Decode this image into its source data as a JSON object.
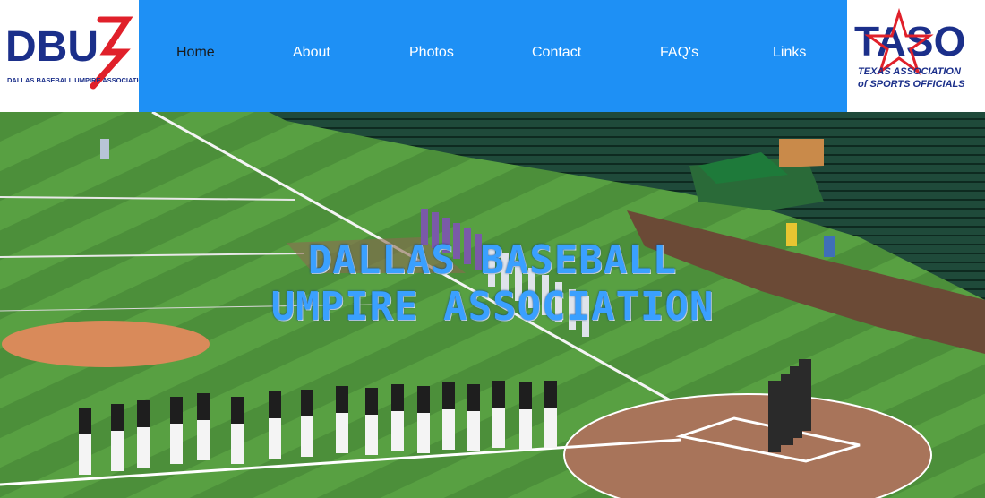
{
  "logo_left": {
    "mark": "DBU",
    "tagline": "DALLAS BASEBALL UMPIRE ASSOCIATION"
  },
  "logo_right": {
    "mark": "TASO",
    "tagline_line1": "TEXAS ASSOCIATION",
    "tagline_line2": "of SPORTS OFFICIALS"
  },
  "nav": {
    "items": [
      {
        "label": "Home",
        "active": true
      },
      {
        "label": "About"
      },
      {
        "label": "Photos"
      },
      {
        "label": "Contact"
      },
      {
        "label": "FAQ's"
      },
      {
        "label": "Links"
      }
    ]
  },
  "hero": {
    "title_line1": "DALLAS BASEBALL",
    "title_line2": "UMPIRE ASSOCIATION"
  },
  "colors": {
    "nav_bg": "#1e90f5",
    "title": "#3aa0ff",
    "brand_red": "#e0202a",
    "brand_navy": "#1b2f8a"
  }
}
